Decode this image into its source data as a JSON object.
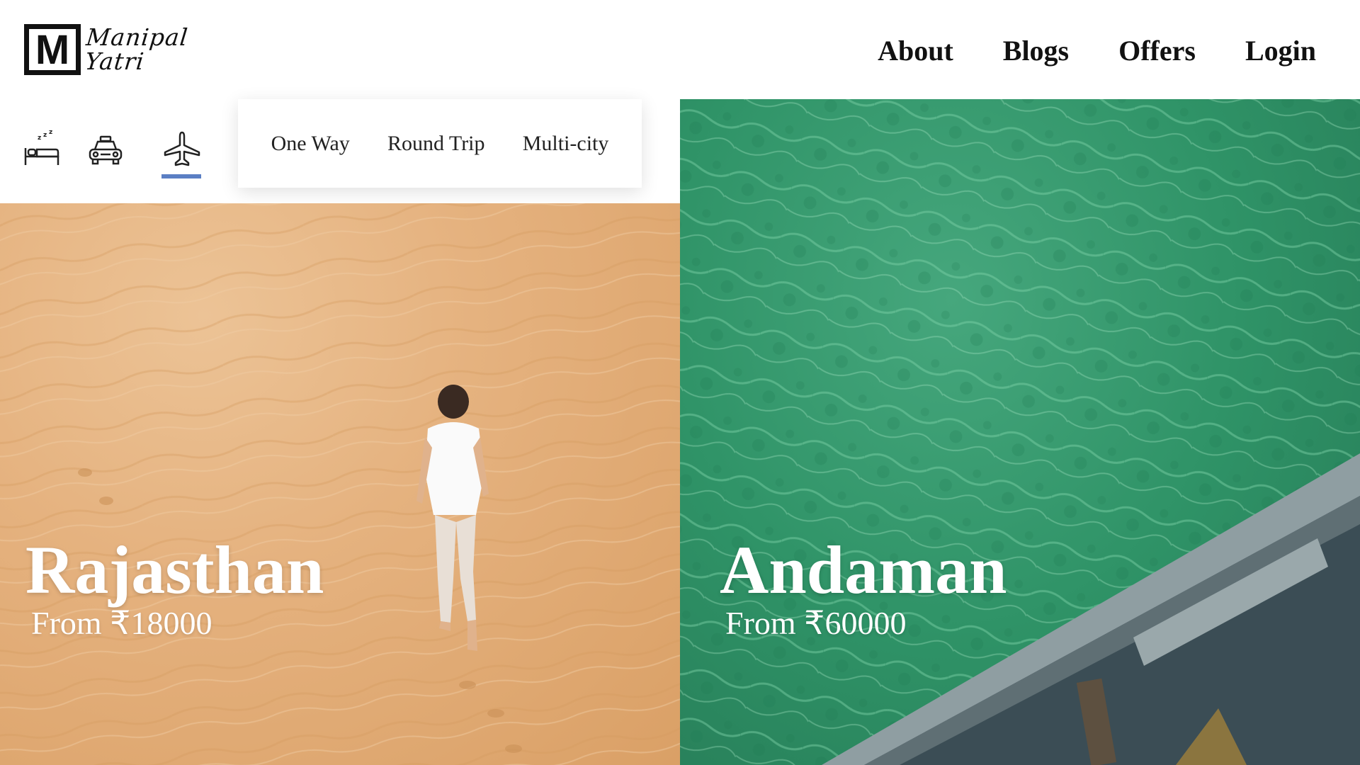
{
  "brand": {
    "logo_letter": "M",
    "logo_line1": "Manipal",
    "logo_line2": "Yatri"
  },
  "nav": {
    "items": [
      "About",
      "Blogs",
      "Offers",
      "Login"
    ]
  },
  "categories": {
    "items": [
      {
        "icon": "hotel-bed-icon"
      },
      {
        "icon": "taxi-icon"
      },
      {
        "icon": "flight-icon",
        "active": true
      }
    ],
    "active_color": "#5b7fc4"
  },
  "trip_types": {
    "options": [
      "One Way",
      "Round Trip",
      "Multi-city"
    ]
  },
  "destinations": [
    {
      "name": "Rajasthan",
      "price": "From ₹18000",
      "theme_color": "#e5b27f"
    },
    {
      "name": "Andaman",
      "price": "From ₹60000",
      "theme_color": "#2f9367"
    }
  ]
}
